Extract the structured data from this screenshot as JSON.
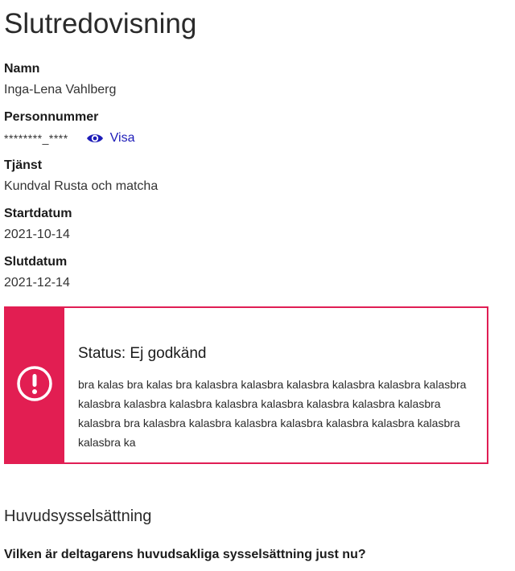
{
  "page": {
    "title": "Slutredovisning"
  },
  "fields": {
    "namn": {
      "label": "Namn",
      "value": "Inga-Lena Vahlberg"
    },
    "personnummer": {
      "label": "Personnummer",
      "value": "********_****",
      "show_label": "Visa",
      "show_icon": "eye-icon"
    },
    "tjanst": {
      "label": "Tjänst",
      "value": "Kundval Rusta och matcha"
    },
    "startdatum": {
      "label": "Startdatum",
      "value": "2021-10-14"
    },
    "slutdatum": {
      "label": "Slutdatum",
      "value": "2021-12-14"
    }
  },
  "status": {
    "title": "Status: Ej godkänd",
    "text": "bra kalas bra kalas bra kalasbra kalasbra kalasbra kalasbra kalasbra kalasbra kalasbra kalasbra kalasbra kalasbra kalasbra kalasbra kalasbra kalasbra kalasbra bra kalasbra kalasbra kalasbra kalasbra kalasbra kalasbra kalasbra kalasbra ka",
    "icon": "exclamation-circle-icon",
    "colors": {
      "accent": "#e21e52",
      "border": "#e01e54"
    }
  },
  "section": {
    "title": "Huvudsysselsättning",
    "question": "Vilken är deltagarens huvudsakliga sysselsättning just nu?"
  },
  "colors": {
    "link": "#1d1cb8",
    "text": "#1b1b1b"
  }
}
